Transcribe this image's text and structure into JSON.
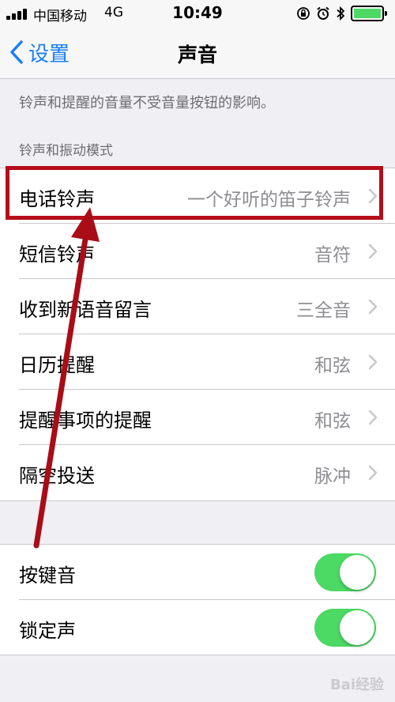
{
  "status_bar": {
    "carrier": "中国移动",
    "network": "4G",
    "time": "10:49",
    "icons": [
      "signal-icon",
      "orientation-lock-icon",
      "alarm-icon",
      "bluetooth-icon",
      "battery-icon"
    ],
    "battery_color": "#4cd964"
  },
  "nav": {
    "back_label": "设置",
    "title": "声音",
    "accent": "#1a7ff5"
  },
  "footnote": "铃声和提醒的音量不受音量按钮的影响。",
  "section_header": "铃声和振动模式",
  "sound_rows": [
    {
      "label": "电话铃声",
      "value": "一个好听的笛子铃声"
    },
    {
      "label": "短信铃声",
      "value": "音符"
    },
    {
      "label": "收到新语音留言",
      "value": "三全音"
    },
    {
      "label": "日历提醒",
      "value": "和弦"
    },
    {
      "label": "提醒事项的提醒",
      "value": "和弦"
    },
    {
      "label": "隔空投送",
      "value": "脉冲"
    }
  ],
  "toggle_rows": [
    {
      "label": "按键音",
      "on": true
    },
    {
      "label": "锁定声",
      "on": true
    }
  ],
  "annotation_color": "#b50d1a",
  "watermark": "Bai经验"
}
